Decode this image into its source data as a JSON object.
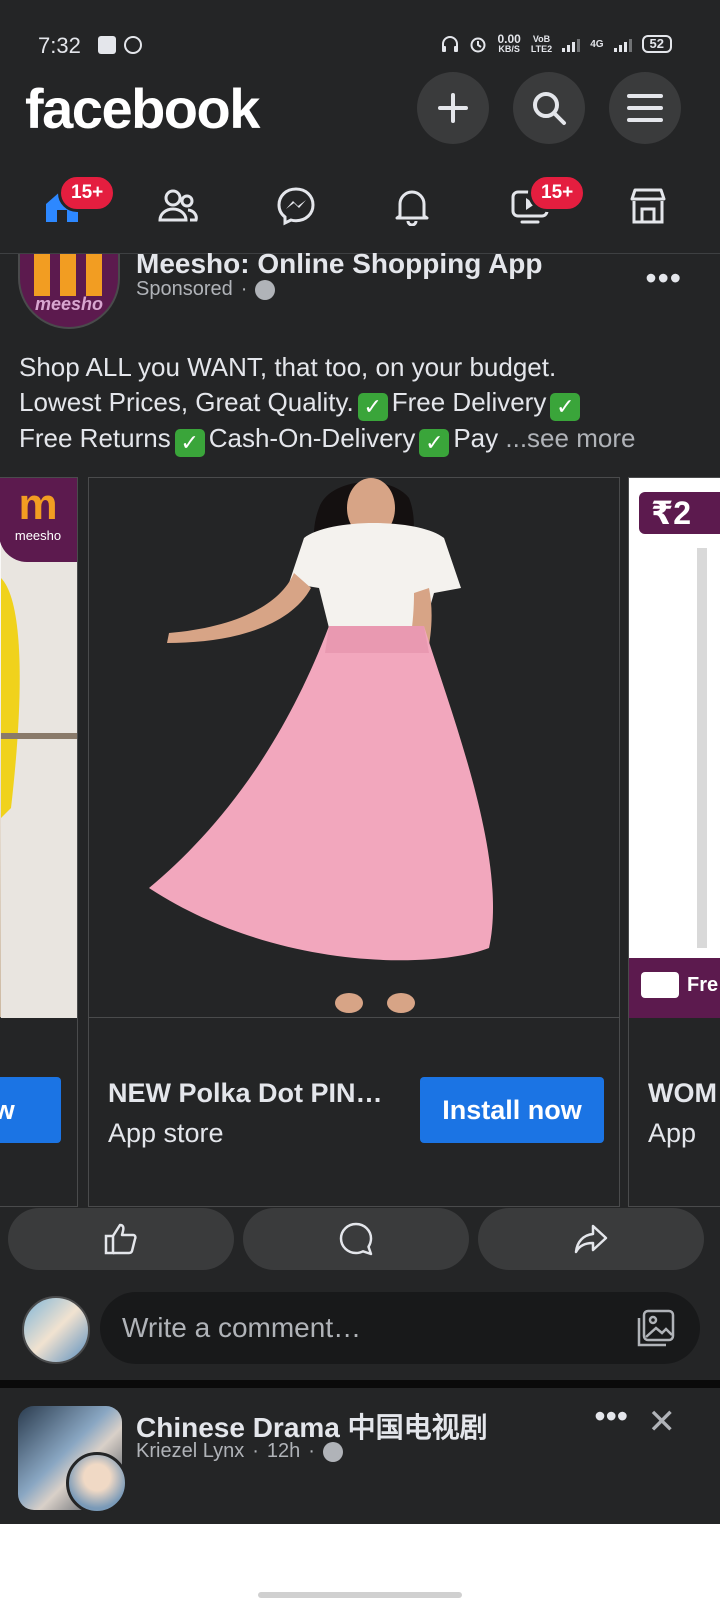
{
  "status_bar": {
    "time": "7:32",
    "speed_value": "0.00",
    "speed_unit": "KB/S",
    "volte_top": "VoB",
    "volte_bottom": "LTE2",
    "network": "4G",
    "battery": "52"
  },
  "header": {
    "logo": "facebook"
  },
  "nav": {
    "home_badge": "15+",
    "video_badge": "15+"
  },
  "post": {
    "page_name": "Meesho: Online Shopping App",
    "avatar_text": "meesho",
    "sponsored": "Sponsored",
    "dot": "·",
    "text_parts": {
      "line1": "Shop ALL you WANT, that too, on your budget.",
      "line2a": "Lowest Prices, Great Quality.",
      "line2b": "Free Delivery",
      "line3a": "Free Returns",
      "line3b": "Cash-On-Delivery",
      "line3c": "Pay",
      "see_more": "...see more"
    },
    "cards": [
      {
        "badge_logo": "m",
        "badge_text": "meesho",
        "button": "ow"
      },
      {
        "title": "NEW Polka Dot PIN…",
        "subtitle": "App store",
        "button": "Install now"
      },
      {
        "price_tag": "₹2",
        "title": "WOM",
        "subtitle": "App",
        "free_label": "Fre"
      }
    ]
  },
  "comment": {
    "placeholder": "Write a comment…"
  },
  "next_post": {
    "title": "Chinese Drama 中国电视剧",
    "author": "Kriezel Lynx",
    "time": "12h",
    "dot": "·"
  }
}
